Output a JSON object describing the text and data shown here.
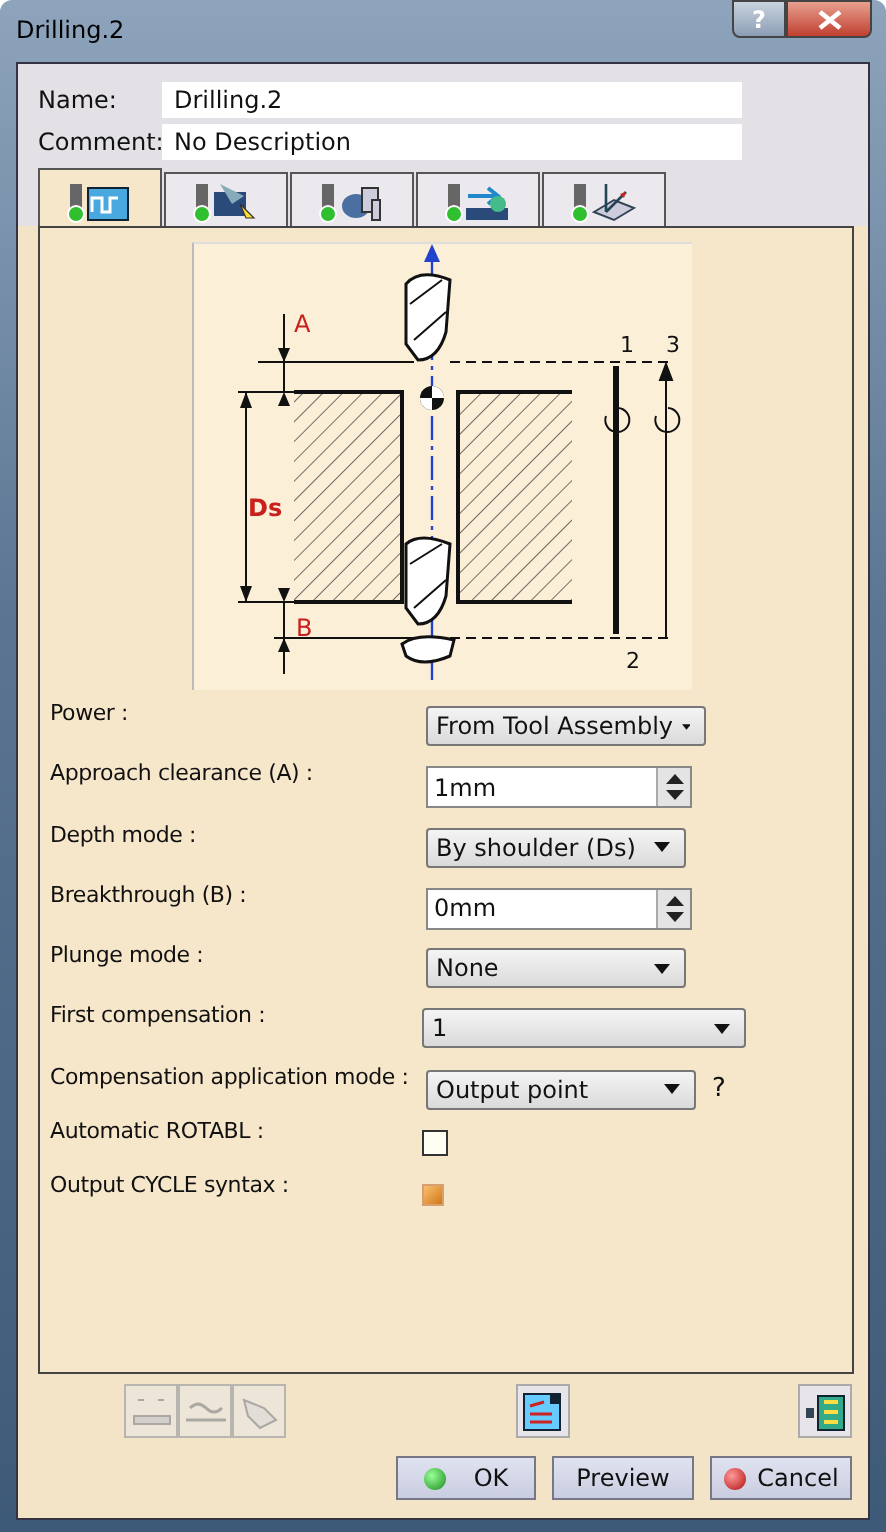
{
  "window": {
    "title": "Drilling.2",
    "help_button": "?"
  },
  "name_field": {
    "label": "Name:",
    "value": "Drilling.2"
  },
  "comment_field": {
    "label": "Comment:",
    "value": "No Description"
  },
  "tabs": [
    {
      "selected": true
    },
    {
      "selected": false
    },
    {
      "selected": false
    },
    {
      "selected": false
    },
    {
      "selected": false
    }
  ],
  "diagram": {
    "label_a": "A",
    "label_ds": "Ds",
    "label_b": "B",
    "marker_1": "1",
    "marker_2": "2",
    "marker_3": "3"
  },
  "parameters": [
    {
      "kind": "dropdown",
      "label": "Power :",
      "value": "From Tool Assembly"
    },
    {
      "kind": "spin",
      "label": "Approach clearance (A) :",
      "value": "1mm"
    },
    {
      "kind": "dropdown",
      "label": "Depth mode :",
      "value": "By shoulder (Ds)"
    },
    {
      "kind": "spin",
      "label": "Breakthrough (B) :",
      "value": "0mm"
    },
    {
      "kind": "dropdown",
      "label": "Plunge mode :",
      "value": "None"
    },
    {
      "kind": "dropdown",
      "label": "First compensation :",
      "value": "1"
    },
    {
      "kind": "dropdown",
      "label": "Compensation application mode :",
      "value": "Output point",
      "help": "?"
    },
    {
      "kind": "checkbox",
      "label": "Automatic ROTABL :",
      "checked": false
    },
    {
      "kind": "checkbox",
      "label": "Output CYCLE syntax :",
      "checked": true
    }
  ],
  "tool_buttons": [
    {
      "disabled": true
    },
    {
      "disabled": true
    },
    {
      "disabled": true
    },
    {
      "disabled": false
    },
    {
      "disabled": false
    }
  ],
  "buttons": [
    {
      "kind": "ok",
      "label": "OK"
    },
    {
      "kind": "plain",
      "label": "Preview"
    },
    {
      "kind": "cancel",
      "label": "Cancel"
    }
  ]
}
